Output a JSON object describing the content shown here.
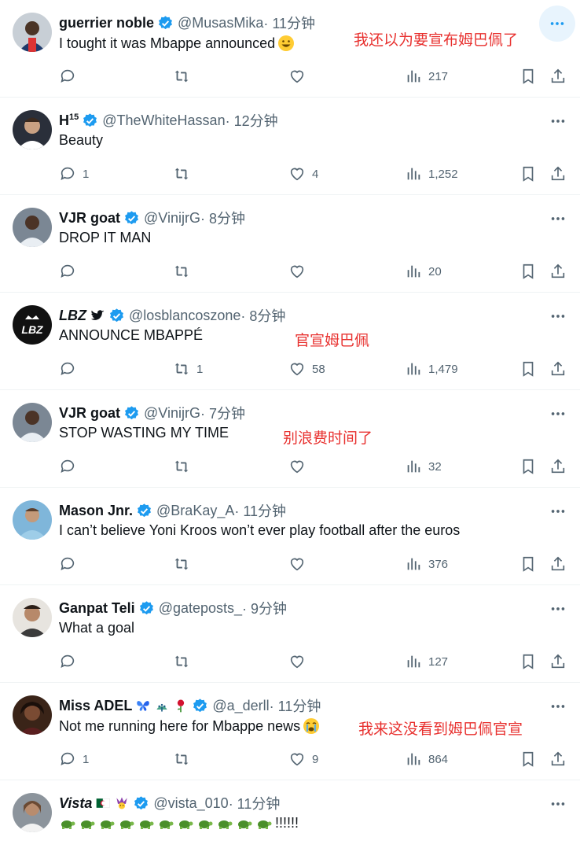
{
  "tweets": [
    {
      "name": "guerrier noble",
      "handle": "@MusasMika",
      "time": "· 11分钟",
      "text": "I tought it was Mbappe announced",
      "replies": "",
      "retweets": "",
      "likes": "",
      "views": "217",
      "annotation": "我还以为要宣布姆巴佩了"
    },
    {
      "name": "H",
      "name_sup": "15",
      "handle": "@TheWhiteHassan",
      "time": "· 12分钟",
      "text": "Beauty",
      "replies": "1",
      "retweets": "",
      "likes": "4",
      "views": "1,252",
      "annotation": ""
    },
    {
      "name": "VJR goat",
      "handle": "@VinijrG",
      "time": "· 8分钟",
      "text": "DROP IT  MAN",
      "replies": "",
      "retweets": "",
      "likes": "",
      "views": "20",
      "annotation": ""
    },
    {
      "name": "LBZ",
      "handle": "@losblancoszone",
      "time": "· 8分钟",
      "text": "ANNOUNCE MBAPPÉ",
      "replies": "",
      "retweets": "1",
      "likes": "58",
      "views": "1,479",
      "annotation": "官宣姆巴佩",
      "avatar_text": "LBZ"
    },
    {
      "name": "VJR goat",
      "handle": "@VinijrG",
      "time": "· 7分钟",
      "text": "STOP WASTING MY TIME",
      "replies": "",
      "retweets": "",
      "likes": "",
      "views": "32",
      "annotation": "别浪费时间了"
    },
    {
      "name": "Mason Jnr.",
      "handle": "@BraKay_A",
      "time": "· 11分钟",
      "text": "I can’t believe Yoni Kroos won’t ever play football after the euros",
      "replies": "",
      "retweets": "",
      "likes": "",
      "views": "376",
      "annotation": ""
    },
    {
      "name": "Ganpat Teli",
      "handle": "@gateposts_",
      "time": "· 9分钟",
      "text": "What a goal",
      "replies": "",
      "retweets": "",
      "likes": "",
      "views": "127",
      "annotation": ""
    },
    {
      "name": "Miss ADEL",
      "handle": "@a_derll",
      "time": "· 11分钟",
      "text": "Not me running here for Mbappe news",
      "replies": "1",
      "retweets": "",
      "likes": "9",
      "views": "864",
      "annotation": "我来这没看到姆巴佩官宣"
    },
    {
      "name": "Vista",
      "handle": "@vista_010",
      "time": "· 11分钟",
      "text": "!!!!!!",
      "replies": "",
      "retweets": "",
      "likes": "",
      "views": "",
      "annotation": ""
    }
  ],
  "colors": {
    "verified": "#1d9bf0",
    "secondary": "#536471",
    "annotation": "#e8312f",
    "divider": "#eff3f4"
  },
  "icons": [
    "reply-icon",
    "retweet-icon",
    "like-icon",
    "views-icon",
    "bookmark-icon",
    "share-icon",
    "more-icon",
    "verified-badge-icon"
  ]
}
